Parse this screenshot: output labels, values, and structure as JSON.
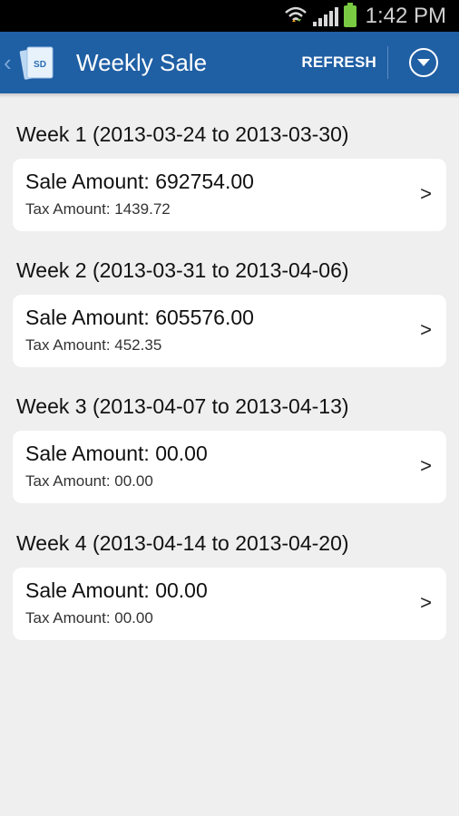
{
  "status_bar": {
    "time": "1:42 PM",
    "icons": [
      "wifi-icon",
      "signal-icon",
      "battery-icon"
    ]
  },
  "action_bar": {
    "title": "Weekly Sale",
    "logo_text": "SD",
    "refresh_label": "REFRESH",
    "up_caret": "‹",
    "overflow_icon": "chevron-down-icon",
    "background_color": "#1f5fa4"
  },
  "weeks": [
    {
      "header": "Week 1 (2013-03-24 to 2013-03-30)",
      "sale": "Sale Amount: 692754.00",
      "tax": "Tax Amount: 1439.72",
      "chevron": ">"
    },
    {
      "header": "Week 2 (2013-03-31 to 2013-04-06)",
      "sale": "Sale Amount: 605576.00",
      "tax": "Tax Amount: 452.35",
      "chevron": ">"
    },
    {
      "header": "Week 3 (2013-04-07 to 2013-04-13)",
      "sale": "Sale Amount: 00.00",
      "tax": "Tax Amount: 00.00",
      "chevron": ">"
    },
    {
      "header": "Week 4 (2013-04-14 to 2013-04-20)",
      "sale": "Sale Amount: 00.00",
      "tax": "Tax Amount: 00.00",
      "chevron": ">"
    }
  ]
}
